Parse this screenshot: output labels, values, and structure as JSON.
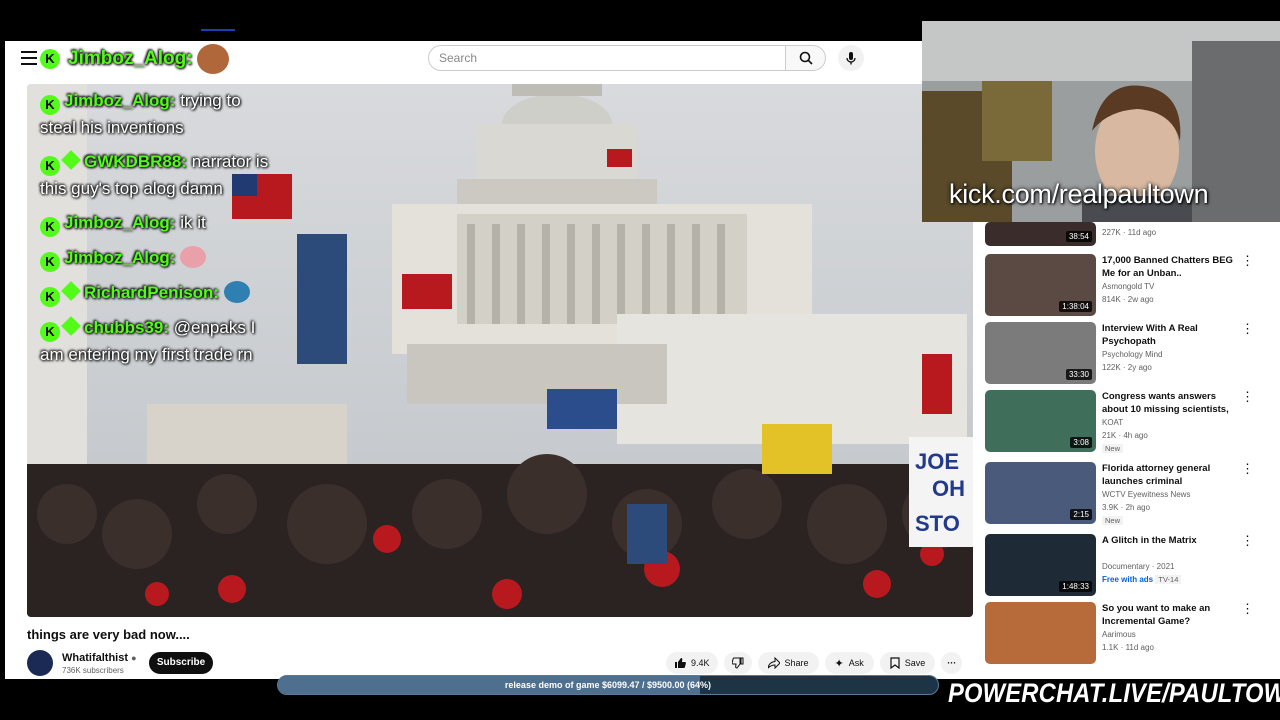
{
  "header": {
    "search_placeholder": "Search"
  },
  "chat_header": {
    "username": "Jimboz_Alog:"
  },
  "chat": [
    {
      "badge": "K",
      "user": "Jimboz_Alog:",
      "text": "trying to steal his inventions",
      "extra_badge": false
    },
    {
      "badge": "K",
      "user": "GWKDBR88:",
      "text": "narrator is this guy's top alog damn",
      "extra_badge": true
    },
    {
      "badge": "K",
      "user": "Jimboz_Alog:",
      "text": "ik it",
      "extra_badge": false
    },
    {
      "badge": "K",
      "user": "Jimboz_Alog:",
      "text": "",
      "extra_badge": false,
      "emote": true
    },
    {
      "badge": "K",
      "user": "RichardPenison:",
      "text": "",
      "extra_badge": true,
      "emote": true
    },
    {
      "badge": "K",
      "user": "chubbs39:",
      "text": "@enpaks I am entering my first trade rn",
      "extra_badge": true
    }
  ],
  "video": {
    "title": "things are very bad now....",
    "channel": "Whatifalthist",
    "subscribers": "736K subscribers",
    "subscribe_label": "Subscribe",
    "likes": "9.4K",
    "share_label": "Share",
    "ask_label": "Ask",
    "save_label": "Save"
  },
  "webcam": {
    "url_text": "kick.com/realpaultown"
  },
  "recommendations": [
    {
      "title": "",
      "channel": "",
      "meta": "227K · 11d ago",
      "duration": "38:54",
      "badge": ""
    },
    {
      "title": "17,000 Banned Chatters BEG Me for an Unban..",
      "channel": "Asmongold TV",
      "meta": "814K · 2w ago",
      "duration": "1:38:04",
      "badge": ""
    },
    {
      "title": "Interview With A Real Psychopath",
      "channel": "Psychology Mind",
      "meta": "122K · 2y ago",
      "duration": "33:30",
      "badge": ""
    },
    {
      "title": "Congress wants answers about 10 missing scientists, several ...",
      "channel": "KOAT",
      "meta": "21K · 4h ago",
      "duration": "3:08",
      "badge": "New"
    },
    {
      "title": "Florida attorney general launches criminal investigatio...",
      "channel": "WCTV Eyewitness News",
      "meta": "3.9K · 2h ago",
      "duration": "2:15",
      "badge": "New"
    },
    {
      "title": "A Glitch in the Matrix",
      "channel": "Documentary · 2021",
      "meta": "Free with ads",
      "meta2": "TV-14",
      "duration": "1:48:33",
      "badge": ""
    },
    {
      "title": "So you want to make an Incremental Game?",
      "channel": "Aarimous",
      "meta": "1.1K · 11d ago",
      "duration": "",
      "badge": ""
    }
  ],
  "goal": {
    "text": "release demo of game $6099.47 / $9500.00 (64%)",
    "fraction": 0.64
  },
  "powerchat": {
    "text": "POWERCHAT.LIVE/PAULTOWN"
  },
  "colors": {
    "kick_green": "#53fc18",
    "goal_bar": "#4f6f8f",
    "subscribe_bg": "#0f0f0f"
  }
}
